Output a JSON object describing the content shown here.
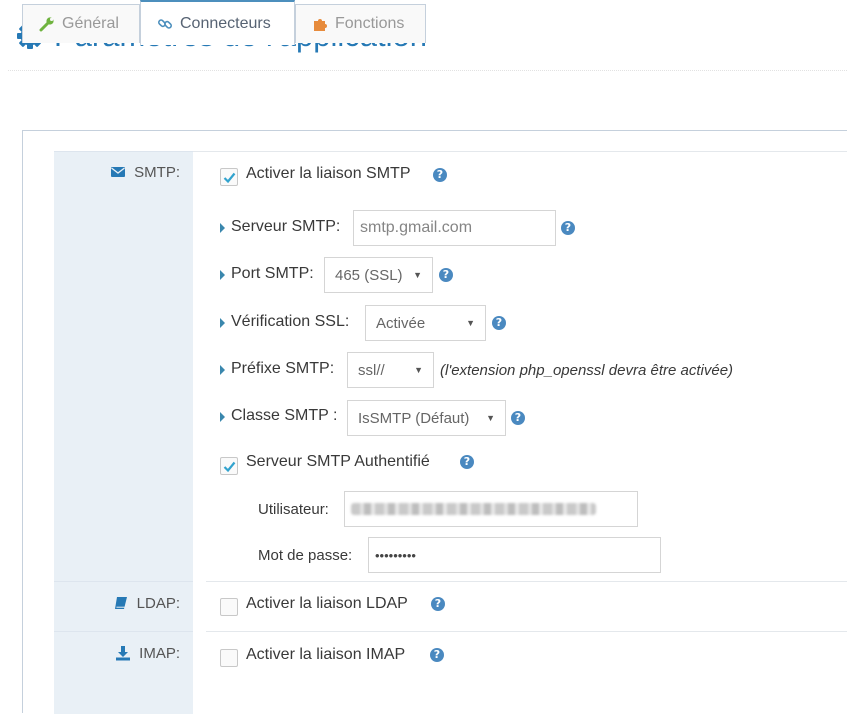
{
  "page": {
    "title": "Paramètres de l'application",
    "title_icon": "cog-icon"
  },
  "colors": {
    "accent": "#2679b5",
    "help": "#4a89c0",
    "label_bg": "#e9f0f6"
  },
  "tabs": [
    {
      "label": "Général",
      "icon": "wrench-icon",
      "active": false
    },
    {
      "label": "Connecteurs",
      "icon": "link-icon",
      "active": true
    },
    {
      "label": "Fonctions",
      "icon": "puzzle-icon",
      "active": false
    }
  ],
  "smtp": {
    "section_label": "SMTP:",
    "enable_label": "Activer la liaison SMTP",
    "enabled": true,
    "server_label": "Serveur SMTP:",
    "server_value": "smtp.gmail.com",
    "port_label": "Port SMTP:",
    "port_value": "465 (SSL)",
    "ssl_label": "Vérification SSL:",
    "ssl_value": "Activée",
    "prefix_label": "Préfixe SMTP:",
    "prefix_value": "ssl//",
    "prefix_note": "(l'extension php_openssl devra être activée)",
    "class_label": "Classe SMTP :",
    "class_value": "IsSMTP (Défaut)",
    "auth_label": "Serveur SMTP Authentifié",
    "auth_enabled": true,
    "user_label": "Utilisateur:",
    "password_label": "Mot de passe:",
    "password_value": "•••••••••"
  },
  "ldap": {
    "section_label": "LDAP:",
    "enable_label": "Activer la liaison LDAP",
    "enabled": false
  },
  "imap": {
    "section_label": "IMAP:",
    "enable_label": "Activer la liaison IMAP",
    "enabled": false
  }
}
